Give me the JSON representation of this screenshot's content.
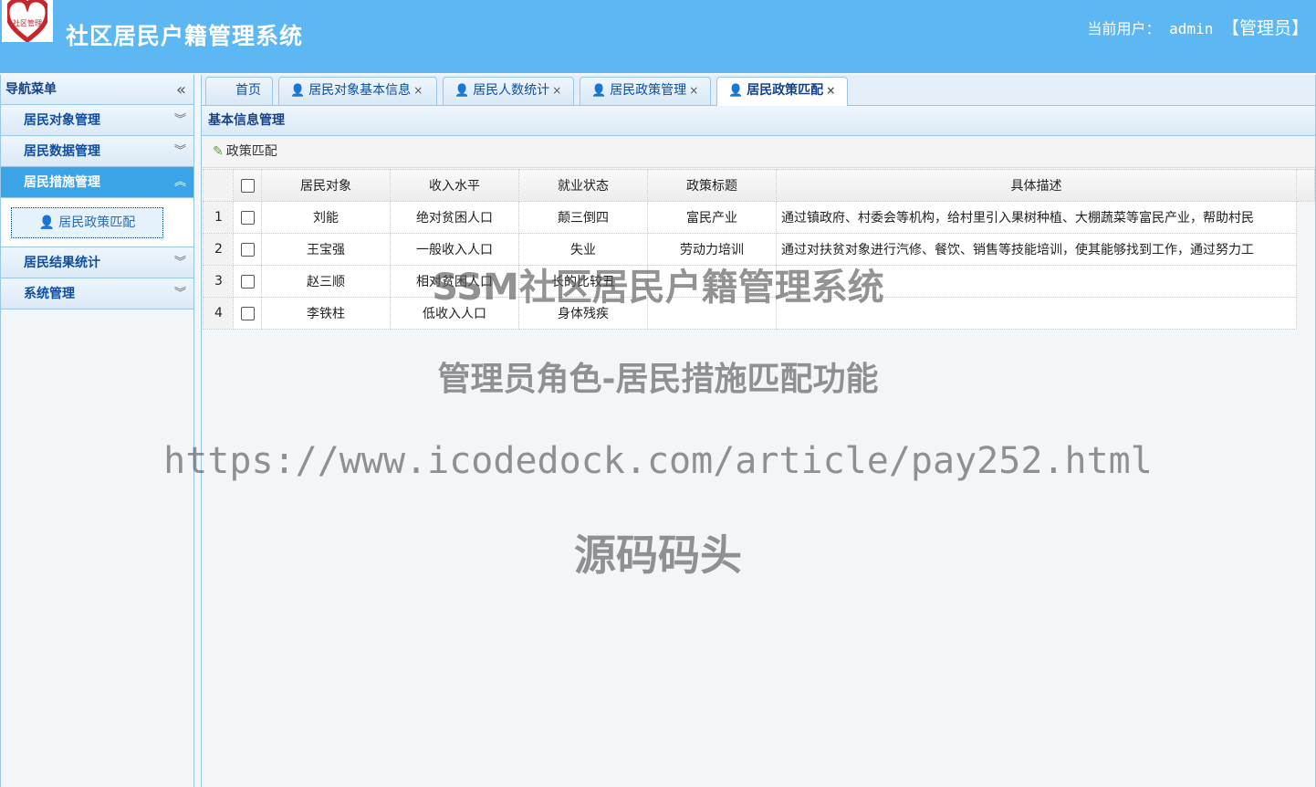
{
  "header": {
    "logo_text": "社区管理",
    "title": "社区居民户籍管理系统",
    "user_label": "当前用户：",
    "username": "admin",
    "role": "【管理员】"
  },
  "sidebar": {
    "title": "导航菜单",
    "groups": [
      {
        "label": "居民对象管理"
      },
      {
        "label": "居民数据管理"
      },
      {
        "label": "居民措施管理",
        "active": true,
        "items": [
          {
            "label": "居民政策匹配"
          }
        ]
      },
      {
        "label": "居民结果统计"
      },
      {
        "label": "系统管理"
      }
    ]
  },
  "tabs": [
    {
      "label": "首页"
    },
    {
      "label": "居民对象基本信息",
      "icon": "person-icon"
    },
    {
      "label": "居民人数统计",
      "icon": "person-icon"
    },
    {
      "label": "居民政策管理",
      "icon": "person-icon"
    },
    {
      "label": "居民政策匹配",
      "icon": "person-icon",
      "active": true
    }
  ],
  "panel": {
    "title": "基本信息管理",
    "toolbar_button": "政策匹配"
  },
  "table": {
    "columns": [
      "居民对象",
      "收入水平",
      "就业状态",
      "政策标题",
      "具体描述"
    ],
    "rows": [
      {
        "num": "1",
        "cells": [
          "刘能",
          "绝对贫困人口",
          "颠三倒四",
          "富民产业",
          "通过镇政府、村委会等机构，给村里引入果树种植、大棚蔬菜等富民产业，帮助村民"
        ]
      },
      {
        "num": "2",
        "cells": [
          "王宝强",
          "一般收入人口",
          "失业",
          "劳动力培训",
          "通过对扶贫对象进行汽修、餐饮、销售等技能培训，使其能够找到工作，通过努力工"
        ]
      },
      {
        "num": "3",
        "cells": [
          "赵三顺",
          "相对贫困人口",
          "长的比较丑",
          "",
          ""
        ]
      },
      {
        "num": "4",
        "cells": [
          "李铁柱",
          "低收入人口",
          "身体残疾",
          "",
          ""
        ]
      }
    ]
  },
  "watermarks": {
    "line1": "SSM社区居民户籍管理系统",
    "line2": "管理员角色-居民措施匹配功能",
    "line3": "https://www.icodedock.com/article/pay252.html",
    "line4": "源码码头"
  },
  "colors": {
    "header_bg": "#5cb7f2",
    "active_nav": "#3ba4e6",
    "border": "#9cc6e6"
  }
}
